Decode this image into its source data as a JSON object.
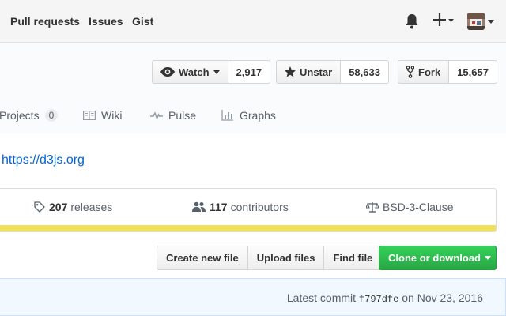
{
  "header": {
    "nav": [
      "Pull requests",
      "Issues",
      "Gist"
    ]
  },
  "repo": {
    "watch": {
      "label": "Watch",
      "count": "2,917"
    },
    "star": {
      "label": "Unstar",
      "count": "58,633"
    },
    "fork": {
      "label": "Fork",
      "count": "15,657"
    },
    "tabs": {
      "projects": {
        "label": "Projects",
        "count": "0"
      },
      "wiki": "Wiki",
      "pulse": "Pulse",
      "graphs": "Graphs"
    }
  },
  "homepage": "https://d3js.org",
  "summary": {
    "releases_count": "207",
    "releases_label": "releases",
    "contributors_count": "117",
    "contributors_label": "contributors",
    "license": "BSD-3-Clause",
    "language_color": "#f1e05a"
  },
  "file_nav": {
    "create": "Create new file",
    "upload": "Upload files",
    "find": "Find file",
    "clone": "Clone or download"
  },
  "commit": {
    "prefix": "Latest commit",
    "sha": "f797dfe",
    "on": "on",
    "date": "Nov 23, 2016"
  }
}
